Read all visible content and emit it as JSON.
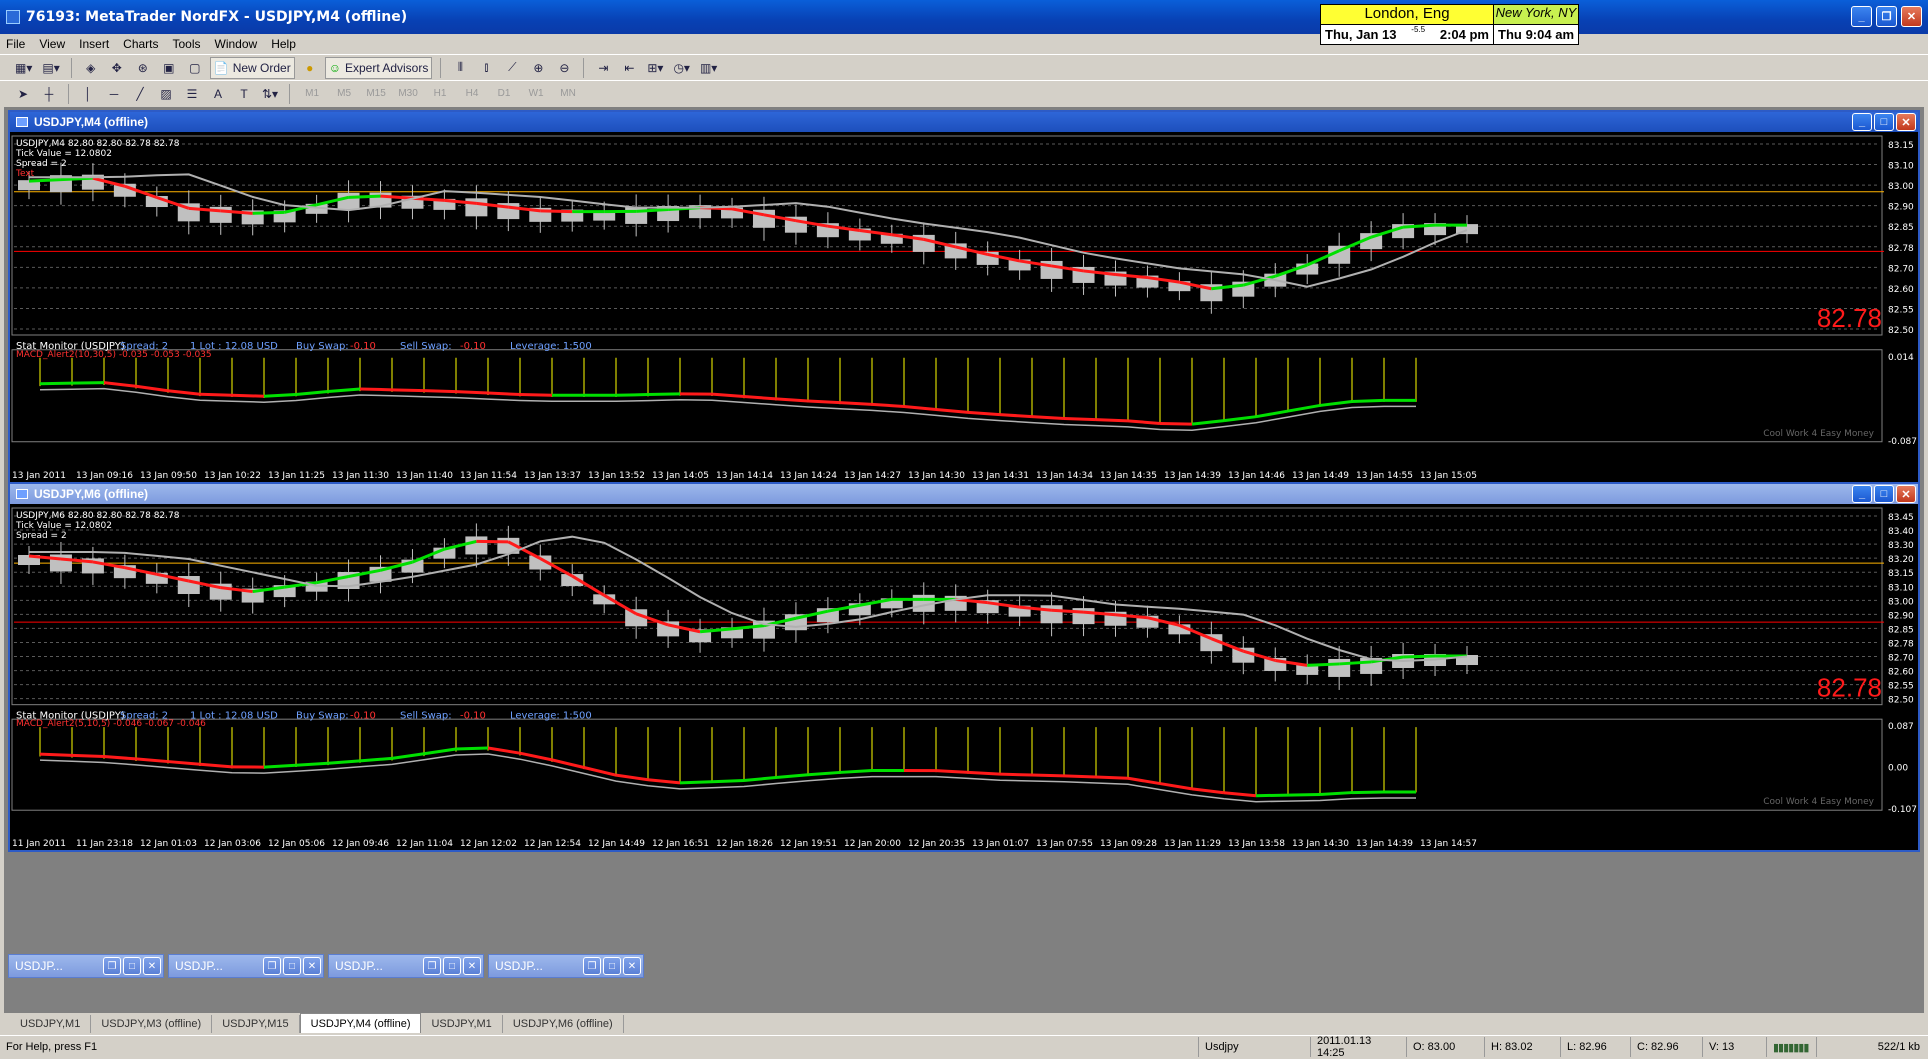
{
  "window": {
    "title": "76193: MetaTrader NordFX - USDJPY,M4 (offline)"
  },
  "clocks": [
    {
      "city": "London, Eng",
      "date": "Thu, Jan 13",
      "time": "2:04 pm",
      "extra": "-5.5"
    },
    {
      "city": "New York, NY",
      "date": "Thu",
      "time": "9:04 am"
    }
  ],
  "menu": [
    "File",
    "View",
    "Insert",
    "Charts",
    "Tools",
    "Window",
    "Help"
  ],
  "toolbar": {
    "new_order": "New Order",
    "expert_advisors": "Expert Advisors",
    "timeframes": [
      "M1",
      "M5",
      "M15",
      "M30",
      "H1",
      "H4",
      "D1",
      "W1",
      "MN"
    ]
  },
  "charts": [
    {
      "title": "USDJPY,M4 (offline)",
      "info": [
        "USDJPY,M4  82.80 82.80 82.78 82.78",
        "Tick Value = 12.0802",
        "Spread = 2",
        "Text"
      ],
      "price_labels": [
        "83.15",
        "83.10",
        "83.00",
        "82.90",
        "82.85",
        "82.78",
        "82.70",
        "82.60",
        "82.55",
        "82.50"
      ],
      "big_price": "82.78",
      "stat_monitor": {
        "label": "Stat Monitor (USDJPY)",
        "spread": "Spread: 2",
        "lot": "1 Lot : 12.08 USD",
        "buy_swap_label": "Buy Swap:",
        "buy_swap": "-0.10",
        "sell_swap_label": "Sell Swap:",
        "sell_swap": "-0.10",
        "leverage": "Leverage: 1:500"
      },
      "macd_label": "MACD_Alert2(10,30,5) -0.035 -0.053 -0.035",
      "macd_scale": [
        "0.014",
        "-0.087"
      ],
      "watermark": "Cool Work 4 Easy Money",
      "time_labels": [
        "13 Jan 2011",
        "13 Jan 09:16",
        "13 Jan 09:50",
        "13 Jan 10:22",
        "13 Jan 11:25",
        "13 Jan 11:30",
        "13 Jan 11:40",
        "13 Jan 11:54",
        "13 Jan 13:37",
        "13 Jan 13:52",
        "13 Jan 14:05",
        "13 Jan 14:14",
        "13 Jan 14:24",
        "13 Jan 14:27",
        "13 Jan 14:30",
        "13 Jan 14:31",
        "13 Jan 14:34",
        "13 Jan 14:35",
        "13 Jan 14:39",
        "13 Jan 14:46",
        "13 Jan 14:49",
        "13 Jan 14:55",
        "13 Jan 15:05"
      ]
    },
    {
      "title": "USDJPY,M6 (offline)",
      "info": [
        "USDJPY,M6  82.80 82.80 82.78 82.78",
        "Tick Value = 12.0802",
        "Spread = 2"
      ],
      "price_labels": [
        "83.45",
        "83.40",
        "83.30",
        "83.20",
        "83.15",
        "83.10",
        "83.00",
        "82.90",
        "82.85",
        "82.78",
        "82.70",
        "82.60",
        "82.55",
        "82.50"
      ],
      "big_price": "82.78",
      "stat_monitor": {
        "label": "Stat Monitor (USDJPY)",
        "spread": "Spread: 2",
        "lot": "1 Lot : 12.08 USD",
        "buy_swap_label": "Buy Swap:",
        "buy_swap": "-0.10",
        "sell_swap_label": "Sell Swap:",
        "sell_swap": "-0.10",
        "leverage": "Leverage: 1:500"
      },
      "macd_label": "MACD_Alert2(5,10,5) -0.046 -0.067 -0.046",
      "macd_scale": [
        "0.087",
        "0.00",
        "-0.107"
      ],
      "watermark": "Cool Work 4 Easy Money",
      "time_labels": [
        "11 Jan 2011",
        "11 Jan 23:18",
        "12 Jan 01:03",
        "12 Jan 03:06",
        "12 Jan 05:06",
        "12 Jan 09:46",
        "12 Jan 11:04",
        "12 Jan 12:02",
        "12 Jan 12:54",
        "12 Jan 14:49",
        "12 Jan 16:51",
        "12 Jan 18:26",
        "12 Jan 19:51",
        "12 Jan 20:00",
        "12 Jan 20:35",
        "13 Jan 01:07",
        "13 Jan 07:55",
        "13 Jan 09:28",
        "13 Jan 11:29",
        "13 Jan 13:58",
        "13 Jan 14:30",
        "13 Jan 14:39",
        "13 Jan 14:57"
      ]
    }
  ],
  "minimized": [
    "USDJP...",
    "USDJP...",
    "USDJP...",
    "USDJP..."
  ],
  "tabs": [
    "USDJPY,M1",
    "USDJPY,M3 (offline)",
    "USDJPY,M15",
    "USDJPY,M4 (offline)",
    "USDJPY,M1",
    "USDJPY,M6 (offline)"
  ],
  "active_tab": 3,
  "status": {
    "help": "For Help, press F1",
    "symbol": "Usdjpy",
    "datetime": "2011.01.13 14:25",
    "open": "O: 83.00",
    "high": "H: 83.02",
    "low": "L: 82.96",
    "close": "C: 82.96",
    "volume": "V: 13",
    "traffic": "522/1 kb"
  },
  "colors": {
    "bull": "#00e000",
    "bear": "#ff1a1a",
    "candle": "#c0c0c0",
    "ask_line": "#ff0000",
    "level_line": "#ffb400",
    "hist": "#ffff00"
  }
}
